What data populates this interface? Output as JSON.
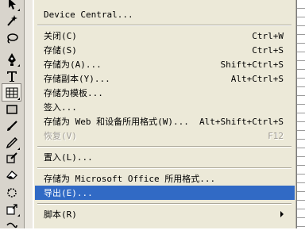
{
  "menu": {
    "items": [
      {
        "label": "Device Central...",
        "shortcut": "",
        "state": "normal"
      },
      {
        "label": "关闭(C)",
        "shortcut": "Ctrl+W",
        "state": "normal"
      },
      {
        "label": "存储(S)",
        "shortcut": "Ctrl+S",
        "state": "normal"
      },
      {
        "label": "存储为(A)...",
        "shortcut": "Shift+Ctrl+S",
        "state": "normal"
      },
      {
        "label": "存储副本(Y)...",
        "shortcut": "Alt+Ctrl+S",
        "state": "normal"
      },
      {
        "label": "存储为模板...",
        "shortcut": "",
        "state": "normal"
      },
      {
        "label": "签入...",
        "shortcut": "",
        "state": "normal"
      },
      {
        "label": "存储为 Web 和设备所用格式(W)...",
        "shortcut": "Alt+Shift+Ctrl+S",
        "state": "normal"
      },
      {
        "label": "恢复(V)",
        "shortcut": "F12",
        "state": "disabled"
      },
      {
        "label": "置入(L)...",
        "shortcut": "",
        "state": "normal"
      },
      {
        "label": "存储为 Microsoft Office 所用格式...",
        "shortcut": "",
        "state": "normal"
      },
      {
        "label": "导出(E)...",
        "shortcut": "",
        "state": "selected"
      },
      {
        "label": "脚本(R)",
        "shortcut": "",
        "state": "normal",
        "submenu": true
      }
    ]
  },
  "toolbar": {
    "tools": [
      "selection-arrow-icon",
      "magic-wand-icon",
      "lasso-icon",
      "pen-icon",
      "type-icon",
      "grid-icon",
      "rectangle-icon",
      "paintbrush-icon",
      "pencil-icon",
      "blob-brush-icon",
      "eraser-icon",
      "rotate-icon",
      "scale-icon",
      "warp-icon"
    ],
    "selected_tool": "grid-icon"
  },
  "colors": {
    "menu_bg": "#ece9d8",
    "highlight": "#316ac5",
    "disabled_text": "#a09c94"
  }
}
